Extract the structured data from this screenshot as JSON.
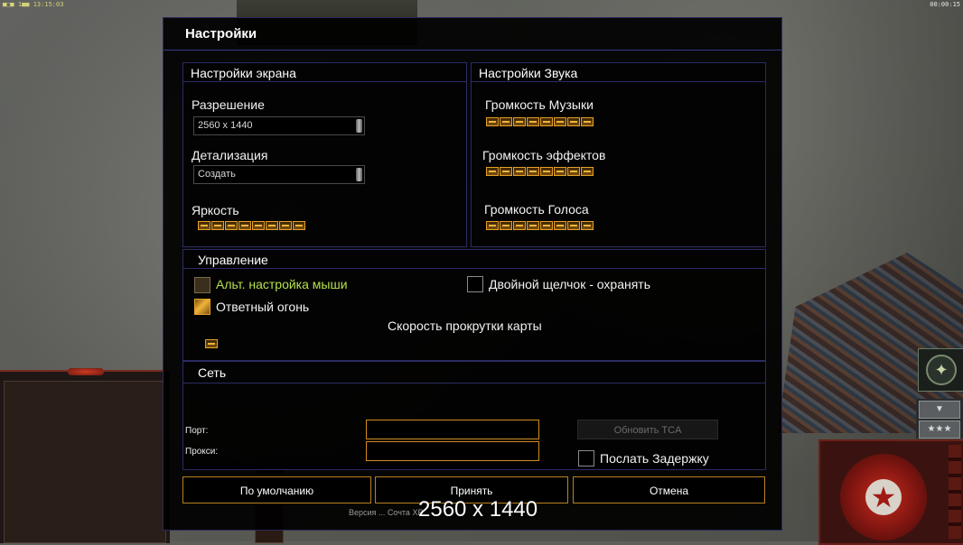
{
  "hud": {
    "top_left_text": "■□■ 1■■ 13:15:03",
    "top_right_text": "00:00:15",
    "stars": "★★★",
    "down_arrow": "▼"
  },
  "dialog": {
    "title": "Настройки"
  },
  "display": {
    "heading": "Настройки экрана",
    "resolution_label": "Разрешение",
    "resolution_value": "2560 x 1440",
    "detail_label": "Детализация",
    "detail_value": "Создать",
    "brightness_label": "Яркость",
    "brightness_level": 8
  },
  "sound": {
    "heading": "Настройки Звука",
    "music_label": "Громкость Музыки",
    "music_level": 8,
    "effects_label": "Громкость эффектов",
    "effects_level": 8,
    "voice_label": "Громкость Голоса",
    "voice_level": 8
  },
  "controls": {
    "heading": "Управление",
    "alt_mouse_label": "Альт. настройка мыши",
    "alt_mouse_checked": false,
    "retaliation_label": "Ответный огонь",
    "retaliation_checked": true,
    "double_click_label": "Двойной щелчок - охранять",
    "double_click_checked": false,
    "scroll_speed_label": "Скорость прокрутки карты",
    "scroll_speed_level": 1
  },
  "network": {
    "heading": "Сеть",
    "port_label": "Порт:",
    "port_value": "",
    "proxy_label": "Прокси:",
    "proxy_value": "",
    "update_button": "Обновить TCA",
    "send_delay_label": "Послать Задержку",
    "send_delay_checked": false
  },
  "footer": {
    "default_button": "По умолчанию",
    "accept_button": "Принять",
    "cancel_button": "Отмена"
  },
  "overlay": {
    "resolution_text": "2560 x 1440",
    "version_text": "Версия ... Сочта ХВ"
  },
  "colors": {
    "accent_orange": "#e6a128",
    "panel_border": "#2b2b63",
    "label_green": "#b5e04a"
  }
}
